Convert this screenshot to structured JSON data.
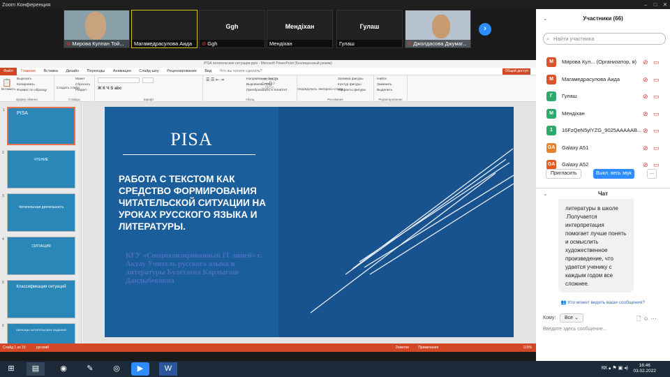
{
  "zoom": {
    "window_title": "Zoom Конференция"
  },
  "videos": [
    {
      "name": "Мирова Кулпан Той..."
    },
    {
      "name": "Магамедрасулова Аида",
      "big": ""
    },
    {
      "name": "Ggh",
      "big": "Ggh"
    },
    {
      "name": "Мендіхан",
      "big": "Мендіхан"
    },
    {
      "name": "Гулаш",
      "big": "Гулаш"
    },
    {
      "name": "Джолдасова Джумаг..."
    }
  ],
  "ppt": {
    "title": "PISA читательские ситуации.pptx - Microsoft PowerPoint (Безлицензный режим)",
    "tabs": [
      "Файл",
      "Главная",
      "Вставка",
      "Дизайн",
      "Переходы",
      "Анимация",
      "Слайд-шоу",
      "Рецензирование",
      "Вид"
    ],
    "tell_me": "Что вы хотите сделать?",
    "share": "Общий доступ",
    "groups": [
      "Буфер обмена",
      "Слайды",
      "Шрифт",
      "Абзац",
      "Рисование",
      "Редактирование"
    ],
    "ribbon_items": {
      "paste": "Вставить",
      "cut": "Вырезать",
      "copy": "Копировать",
      "format": "Формат по образцу",
      "new_slide": "Создать слайд",
      "layout": "Макет",
      "reset": "Сбросить",
      "section": "Раздел",
      "text_dir": "Направление текста",
      "align_text": "Выровнять текст",
      "smartart": "Преобразовать в SmartArt",
      "arrange": "Упорядочить",
      "quick_styles": "Экспресс-стили",
      "fill": "Заливка фигуры",
      "outline": "Контур фигуры",
      "effects": "Эффекты фигуры",
      "find": "Найти",
      "replace": "Заменить",
      "select": "Выделить"
    },
    "thumbs": [
      {
        "num": "1",
        "label": "PISA"
      },
      {
        "num": "2",
        "label": "ЧТЕНИЕ"
      },
      {
        "num": "3",
        "label": "Читательская деятельность"
      },
      {
        "num": "4",
        "label": "СИТУАЦИЯ"
      },
      {
        "num": "5",
        "label": "Классификация ситуаций"
      },
      {
        "num": "6",
        "label": "ОБРАЗЦЫ ЧИТАТЕЛЬСКИХ ЗАДАНИЙ"
      }
    ],
    "slide": {
      "heading": "PISA",
      "title": "РАБОТА С ТЕКСТОМ КАК СРЕДСТВО ФОРМИРОВАНИЯ ЧИТАТЕЛЬСКОЙ СИТУАЦИИ НА УРОКАХ РУССКОГО ЯЗЫКА И ЛИТЕРАТУРЫ.",
      "subtitle": "КГУ «Специализированный IT лицей» г. Актау Учитель русского языка и литературы Булетаева Карлыгаш Дандыбековна"
    },
    "status": {
      "slide_of": "Слайд 1 из 15",
      "lang": "русский",
      "notes": "Заметки",
      "comments": "Примечания",
      "zoom": "115%"
    }
  },
  "panel": {
    "participants_title": "Участники (66)",
    "search_placeholder": "Найти участника",
    "participants": [
      {
        "initial": "М",
        "name": "Мирова Кул... (Организатор, я)",
        "color": "#d9542b"
      },
      {
        "initial": "М",
        "name": "Магамедрасулова Аида",
        "color": "#d9542b"
      },
      {
        "initial": "Г",
        "name": "Гулаш",
        "color": "#2daa6a"
      },
      {
        "initial": "М",
        "name": "Мендіхан",
        "color": "#2daa6a"
      },
      {
        "initial": "1",
        "name": "16FzQeN5ylYZG_9025AAAAAB...",
        "color": "#2daa6a"
      },
      {
        "initial": "GA",
        "name": "Galaxy A51",
        "color": "#e8822a"
      },
      {
        "initial": "GA",
        "name": "Galaxy A52",
        "color": "#e05a21"
      }
    ],
    "invite": "Пригласить",
    "mute_all": "Выкл. весь звук",
    "more": "...",
    "chat_title": "Чат",
    "chat_message": "литературы в школе .Получается интерпретация помогает лучше понять и осмыслить художественное произведение, что удается ученику с каждым годом все сложнее.",
    "who_sees": "Кто может видеть ваши сообщения?",
    "to_label": "Кому:",
    "to_value": "Все",
    "input_placeholder": "Введите здесь сообщение..."
  },
  "taskbar": {
    "lang": "КК",
    "time": "16:46",
    "date": "03.02.2022"
  }
}
